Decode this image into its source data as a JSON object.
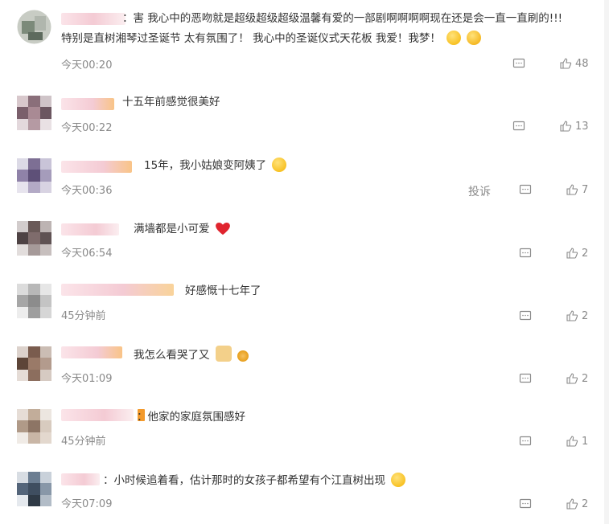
{
  "comments": [
    {
      "text_line1": "：害 我心中的恶吻就是超级超级超级温馨有爱的一部剧啊啊啊啊现在还是会一直一直刷的!!!",
      "text_line2": "特别是直树湘琴过圣诞节 太有氛围了！ 我心中的圣诞仪式天花板 我爱！我梦！",
      "time": "今天00:20",
      "likes": "48",
      "emojis": [
        "laughing-face",
        "crying-face"
      ]
    },
    {
      "text": "十五年前感觉很美好",
      "time": "今天00:22",
      "likes": "13"
    },
    {
      "text": "15年，我小姑娘变阿姨了",
      "time": "今天00:36",
      "likes": "7",
      "report": "投诉",
      "emojis": [
        "crying-laugh-face"
      ]
    },
    {
      "text": "满墙都是小可爱",
      "time": "今天06:54",
      "likes": "2",
      "emojis": [
        "red-heart"
      ]
    },
    {
      "text": "好感慨十七年了",
      "time": "45分钟前",
      "likes": "2"
    },
    {
      "text": "我怎么看哭了又",
      "time": "今天01:09",
      "likes": "2",
      "emojis": [
        "crying-dog",
        "small-face"
      ]
    },
    {
      "text": "：他家的家庭氛围感好",
      "time": "45分钟前",
      "likes": "1"
    },
    {
      "text": "：小时候追着看，估计那时的女孩子都希望有个江直树出现",
      "time": "今天07:09",
      "likes": "2",
      "emojis": [
        "grinning-face"
      ]
    }
  ],
  "colors": {
    "text": "#333333",
    "meta": "#8a8a8a",
    "name_blur": "#f3c9d2",
    "accent_orange": "#f6b25a"
  }
}
